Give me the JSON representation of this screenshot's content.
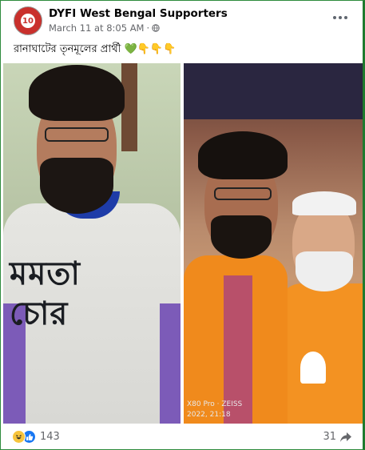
{
  "post": {
    "page_name": "DYFI West Bengal Supporters",
    "timestamp": "March 11 at 8:05 AM",
    "avatar_text": "10",
    "caption": "রানাঘাটের তৃনমূলের প্রার্থী 💚👇👇👇",
    "more_icon": "more-horizontal-icon",
    "privacy_icon": "globe-icon"
  },
  "photos": {
    "left": {
      "shirt_text_line1": "মমতা",
      "shirt_text_line2": "চোর"
    },
    "right": {
      "watermark_line1": "X80 Pro · ZEISS",
      "watermark_line2": "2022, 21:18"
    }
  },
  "footer": {
    "reaction_icons": [
      "haha-icon",
      "like-icon"
    ],
    "reaction_count": "143",
    "share_count": "31",
    "share_icon": "share-arrow-icon"
  },
  "colors": {
    "border": "#2e8b3d",
    "meta_text": "#65676b",
    "like_blue": "#1877f2",
    "haha_yellow": "#f7c43d"
  }
}
